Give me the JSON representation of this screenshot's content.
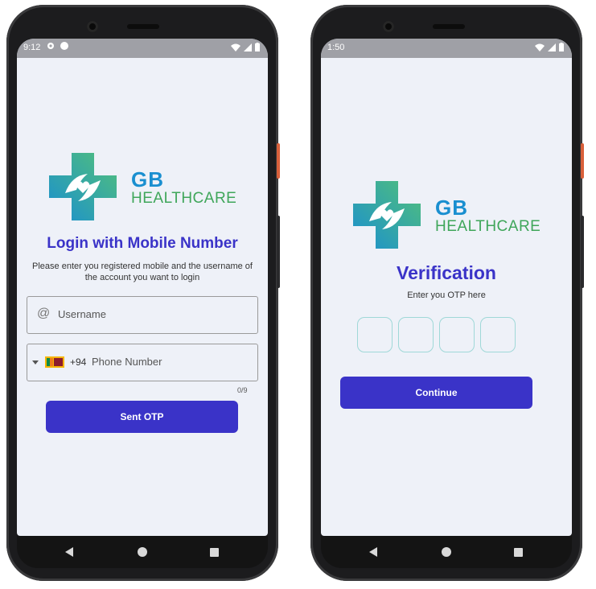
{
  "phone_left": {
    "status": {
      "time": "9:12"
    },
    "brand": {
      "gb": "GB",
      "healthcare": "HEALTHCARE"
    },
    "title": "Login with Mobile Number",
    "subtitle_line1": "Please enter you registered mobile and the username of",
    "subtitle_line2": "the account you want to login",
    "username_placeholder": "Username",
    "country_code": "+94",
    "phone_placeholder": "Phone Number",
    "char_counter": "0/9",
    "submit_label": "Sent OTP"
  },
  "phone_right": {
    "status": {
      "time": "1:50"
    },
    "brand": {
      "gb": "GB",
      "healthcare": "HEALTHCARE"
    },
    "title": "Verification",
    "subtitle": "Enter you OTP here",
    "otp_digits": [
      "",
      "",
      "",
      ""
    ],
    "submit_label": "Continue"
  },
  "colors": {
    "accent": "#3a33c8",
    "brand_blue": "#1a8fd0",
    "brand_green": "#3fa65a",
    "screen_bg": "#eef1f8"
  }
}
